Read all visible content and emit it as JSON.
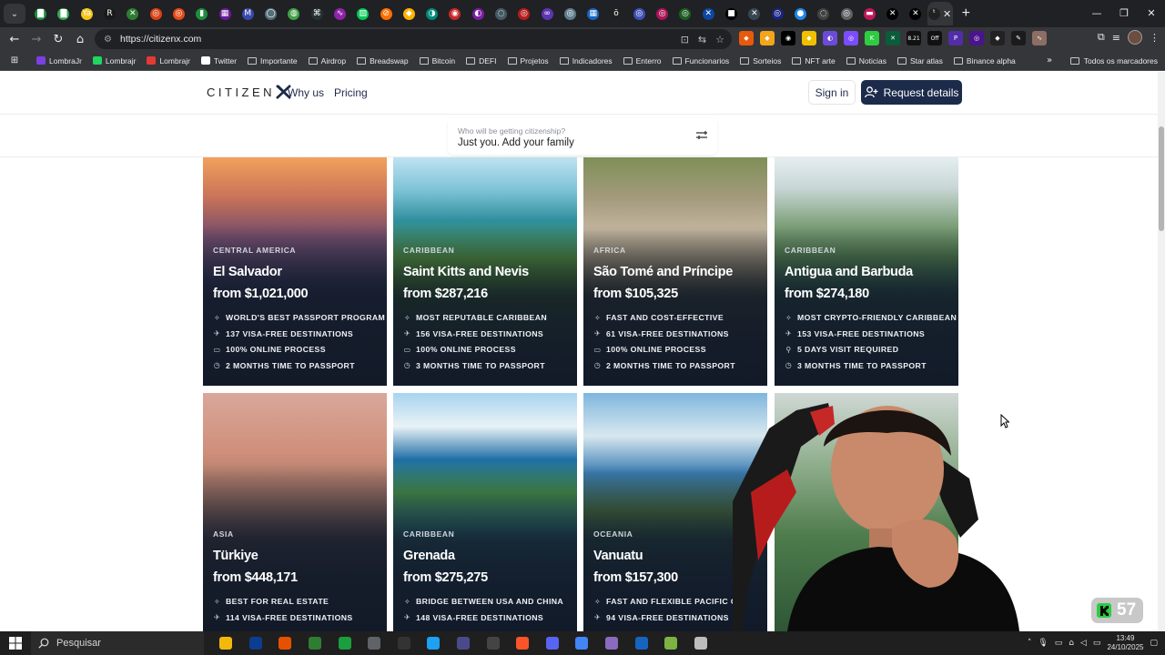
{
  "browser": {
    "url": "https://citizenx.com",
    "tab_colors": [
      "#1e8e3e",
      "#34a853",
      "#f5c518",
      "#1a1a1a",
      "#2e7d32",
      "#d84315",
      "#e64a19",
      "#1e8e3e",
      "#6a1b9a",
      "#3949ab",
      "#546e7a",
      "#43a047",
      "#263238",
      "#8e24aa",
      "#00c853",
      "#ff6f00",
      "#ffb300",
      "#00897b",
      "#c62828",
      "#7b1fa2",
      "#455a64",
      "#b71c1c",
      "#5e35b1",
      "#607d8b",
      "#1565c0",
      "#212121",
      "#3f51b5",
      "#ad1457",
      "#1b5e20",
      "#0d47a1",
      "#000000",
      "#37474f",
      "#1a237e",
      "#1e88e5",
      "#424242",
      "#616161",
      "#c2185b",
      "#000000",
      "#000000",
      "#212121"
    ],
    "tab_glyphs": [
      "▇",
      "▇",
      "Ya",
      "R",
      "✕",
      "◎",
      "◎",
      "▮",
      "▦",
      "M",
      "◯",
      "◍",
      "⌘",
      "∿",
      "▨",
      "⊘",
      "◆",
      "◑",
      "◉",
      "◐",
      "◌",
      "◎",
      "∞",
      "◎",
      "▦",
      "ō",
      "◎",
      "◎",
      "◎",
      "✕",
      "■",
      "✕",
      "◎",
      "●",
      "◌",
      "◎",
      "▬",
      "✕",
      "✕",
      "ᵗ"
    ],
    "bookmarks": [
      {
        "label": "LombraJr",
        "color": "#7b3fe4"
      },
      {
        "label": "Lombrajr",
        "color": "#1ed760"
      },
      {
        "label": "Lombrajr",
        "color": "#e53935"
      },
      {
        "label": "Twitter",
        "color": "#ffffff"
      },
      {
        "label": "Importante",
        "color": ""
      },
      {
        "label": "Airdrop",
        "color": ""
      },
      {
        "label": "Breadswap",
        "color": ""
      },
      {
        "label": "Bitcoin",
        "color": ""
      },
      {
        "label": "DEFI",
        "color": ""
      },
      {
        "label": "Projetos",
        "color": ""
      },
      {
        "label": "Indicadores",
        "color": ""
      },
      {
        "label": "Enterro",
        "color": ""
      },
      {
        "label": "Funcionarios",
        "color": ""
      },
      {
        "label": "Sorteios",
        "color": ""
      },
      {
        "label": "NFT arte",
        "color": ""
      },
      {
        "label": "Noticias",
        "color": ""
      },
      {
        "label": "Star atlas",
        "color": ""
      },
      {
        "label": "Binance alpha",
        "color": ""
      }
    ],
    "all_bookmarks_label": "Todos os marcadores",
    "ext_badge": "8.21",
    "ext_badge2": "Off"
  },
  "site": {
    "logo": "CITIZEN",
    "nav": [
      "Why us",
      "Pricing"
    ],
    "signin": "Sign in",
    "request": "Request details",
    "filter_placeholder": "Who will be getting citizenship?",
    "filter_value": "Just you. Add your family",
    "accent": "#1c2b4a"
  },
  "cards": [
    {
      "region": "CENTRAL AMERICA",
      "name": "El Salvador",
      "price": "from $1,021,000",
      "features": [
        {
          "icon": "sparkle-icon",
          "text": "WORLD'S BEST PASSPORT PROGRAM"
        },
        {
          "icon": "plane-icon",
          "text": "137 VISA-FREE DESTINATIONS"
        },
        {
          "icon": "laptop-icon",
          "text": "100% ONLINE PROCESS"
        },
        {
          "icon": "clock-icon",
          "text": "2 MONTHS TIME TO PASSPORT"
        }
      ]
    },
    {
      "region": "CARIBBEAN",
      "name": "Saint Kitts and Nevis",
      "price": "from $287,216",
      "features": [
        {
          "icon": "sparkle-icon",
          "text": "MOST REPUTABLE CARIBBEAN"
        },
        {
          "icon": "plane-icon",
          "text": "156 VISA-FREE DESTINATIONS"
        },
        {
          "icon": "laptop-icon",
          "text": "100% ONLINE PROCESS"
        },
        {
          "icon": "clock-icon",
          "text": "3 MONTHS TIME TO PASSPORT"
        }
      ]
    },
    {
      "region": "AFRICA",
      "name": "São Tomé and Príncipe",
      "price": "from $105,325",
      "features": [
        {
          "icon": "sparkle-icon",
          "text": "FAST AND COST-EFFECTIVE"
        },
        {
          "icon": "plane-icon",
          "text": "61 VISA-FREE DESTINATIONS"
        },
        {
          "icon": "laptop-icon",
          "text": "100% ONLINE PROCESS"
        },
        {
          "icon": "clock-icon",
          "text": "2 MONTHS TIME TO PASSPORT"
        }
      ]
    },
    {
      "region": "CARIBBEAN",
      "name": "Antigua and Barbuda",
      "price": "from $274,180",
      "features": [
        {
          "icon": "sparkle-icon",
          "text": "MOST CRYPTO-FRIENDLY CARIBBEAN"
        },
        {
          "icon": "plane-icon",
          "text": "153 VISA-FREE DESTINATIONS"
        },
        {
          "icon": "pin-icon",
          "text": "5 DAYS VISIT REQUIRED"
        },
        {
          "icon": "clock-icon",
          "text": "3 MONTHS TIME TO PASSPORT"
        }
      ]
    },
    {
      "region": "ASIA",
      "name": "Türkiye",
      "price": "from $448,171",
      "features": [
        {
          "icon": "sparkle-icon",
          "text": "BEST FOR REAL ESTATE"
        },
        {
          "icon": "plane-icon",
          "text": "114 VISA-FREE DESTINATIONS"
        }
      ]
    },
    {
      "region": "CARIBBEAN",
      "name": "Grenada",
      "price": "from $275,275",
      "features": [
        {
          "icon": "sparkle-icon",
          "text": "BRIDGE BETWEEN USA AND CHINA"
        },
        {
          "icon": "plane-icon",
          "text": "148 VISA-FREE DESTINATIONS"
        }
      ]
    },
    {
      "region": "OCEANIA",
      "name": "Vanuatu",
      "price": "from $157,300",
      "features": [
        {
          "icon": "sparkle-icon",
          "text": "FAST AND FLEXIBLE PACIFIC O"
        },
        {
          "icon": "plane-icon",
          "text": "94 VISA-FREE DESTINATIONS"
        }
      ]
    },
    {
      "region": "",
      "name": "",
      "price": "",
      "features": []
    }
  ],
  "overlay": {
    "badge_count": "57"
  },
  "taskbar": {
    "search": "Pesquisar",
    "time": "13:49",
    "date": "24/10/2025",
    "app_colors": [
      "#f2b90c",
      "#0b3d91",
      "#e65100",
      "#2e7d32",
      "#1b9e3e",
      "#5f6368",
      "#333333",
      "#1da1f2",
      "#4a4a8a",
      "#444444",
      "#fb542b",
      "#5865f2",
      "#4285f4",
      "#8a6bbf",
      "#1565c0",
      "#7cb342",
      "#bdbdbd"
    ]
  }
}
